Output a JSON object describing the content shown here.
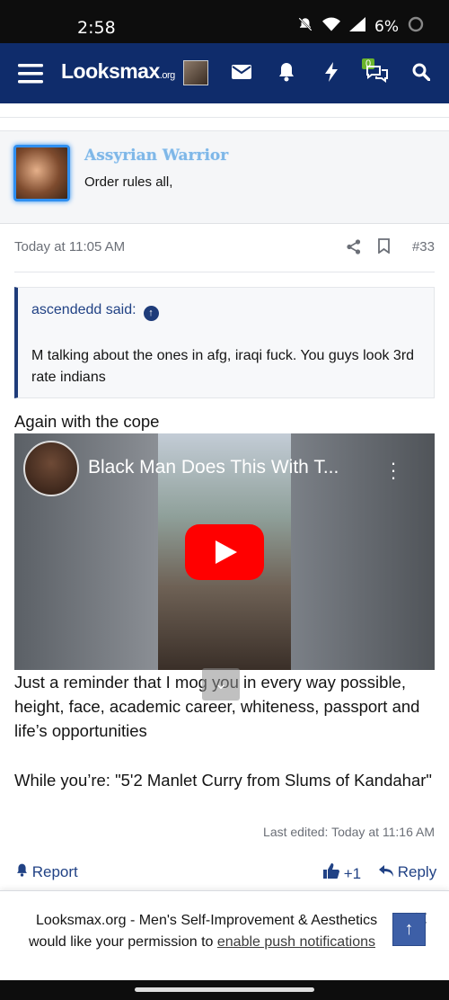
{
  "status_bar": {
    "time": "2:58",
    "battery": "6%",
    "icons": [
      "mute-icon",
      "wifi-icon",
      "signal-icon",
      "battery-icon"
    ]
  },
  "navbar": {
    "logo_main": "Looksmax",
    "logo_suffix": ".org",
    "conversations_badge": "0",
    "icons": [
      "menu-icon",
      "avatar",
      "mail-icon",
      "bell-icon",
      "bolt-icon",
      "chat-icon",
      "search-icon"
    ],
    "accent_color": "#0f2c6b"
  },
  "quoted_post": {
    "author": "Assyrian Warrior",
    "text": "Order rules all,"
  },
  "post": {
    "timestamp": "Today at 11:05 AM",
    "number": "#33",
    "blockquote": {
      "header": "ascendedd said:",
      "body": "M talking about the ones in afg, iraqi fuck. You guys look 3rd rate indians"
    },
    "line1": "Again with the cope",
    "video": {
      "title": "Black Man Does This With T..."
    },
    "paragraph": "Just a reminder that I mog you in every way possible, height, face, academic career, whiteness, passport and life’s opportunities",
    "paragraph2": "While you’re: \"5'2 Manlet Curry from Slums of Kandahar\"",
    "last_edited": "Last edited: Today at 11:16 AM",
    "actions": {
      "report": "Report",
      "like": "+1",
      "reply": "Reply"
    }
  },
  "notification_banner": {
    "line1": "Looksmax.org - Men's Self-Improvement & Aesthetics",
    "line2_prefix": "would like your permission to ",
    "line2_link": "enable push notifications"
  }
}
